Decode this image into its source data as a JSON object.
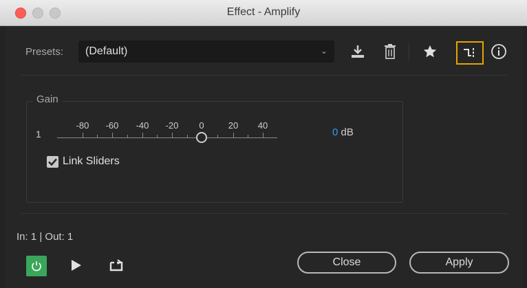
{
  "window": {
    "title": "Effect - Amplify"
  },
  "presets": {
    "label": "Presets:",
    "value": "(Default)"
  },
  "gain": {
    "title": "Gain",
    "channel_label": "1",
    "scale_labels": [
      "-80",
      "-60",
      "-40",
      "-20",
      "0",
      "20",
      "40"
    ],
    "value": "0",
    "unit": "dB",
    "level_db": 0
  },
  "link_sliders": {
    "label": "Link Sliders",
    "checked": true
  },
  "io": {
    "text": "In: 1 | Out: 1"
  },
  "buttons": {
    "close": "Close",
    "apply": "Apply"
  },
  "icons": {
    "toolbar": [
      "download-preset-icon",
      "trash-icon",
      "star-icon",
      "routing-icon",
      "info-icon"
    ],
    "transport": [
      "power-icon",
      "play-icon",
      "loop-icon"
    ]
  },
  "colors": {
    "power_active": "#3aa65a",
    "routing_highlight": "#e6a400",
    "value_accent": "#2f9cff"
  }
}
